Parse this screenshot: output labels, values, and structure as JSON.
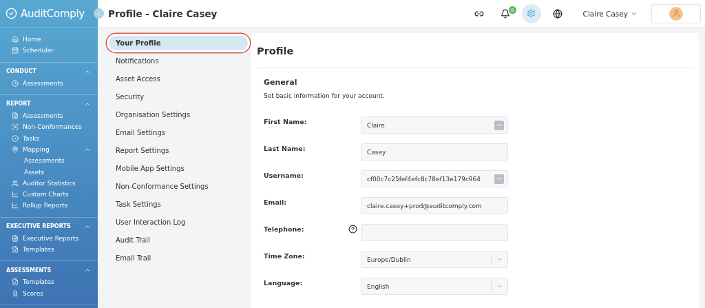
{
  "sidebar": {
    "logo": "AuditComply",
    "top_items": [
      {
        "label": "Home"
      },
      {
        "label": "Scheduler"
      }
    ],
    "sections": [
      {
        "title": "CONDUCT",
        "expanded": true,
        "items": [
          {
            "label": "Assessments"
          }
        ]
      },
      {
        "title": "REPORT",
        "expanded": true,
        "items": [
          {
            "label": "Assessments"
          },
          {
            "label": "Non-Conformances"
          },
          {
            "label": "Tasks"
          },
          {
            "label": "Mapping",
            "expanded": true,
            "children": [
              {
                "label": "Assessments"
              },
              {
                "label": "Assets"
              }
            ]
          },
          {
            "label": "Auditor Statistics"
          },
          {
            "label": "Custom Charts"
          },
          {
            "label": "Rollup Reports"
          }
        ]
      },
      {
        "title": "EXECUTIVE REPORTS",
        "expanded": true,
        "items": [
          {
            "label": "Executive Reports"
          },
          {
            "label": "Templates"
          }
        ]
      },
      {
        "title": "ASSESSMENTS",
        "expanded": true,
        "items": [
          {
            "label": "Templates"
          },
          {
            "label": "Scores"
          }
        ]
      }
    ]
  },
  "header": {
    "title": "Profile - Claire Casey",
    "notifications": "6",
    "user": "Claire Casey"
  },
  "settings_menu": [
    {
      "label": "Your Profile",
      "selected": true
    },
    {
      "label": "Notifications",
      "selected": false
    },
    {
      "label": "Asset Access",
      "selected": false
    },
    {
      "label": "Security",
      "selected": false
    },
    {
      "label": "Organisation Settings",
      "selected": false
    },
    {
      "label": "Email Settings",
      "selected": false
    },
    {
      "label": "Report Settings",
      "selected": false
    },
    {
      "label": "Mobile App Settings",
      "selected": false
    },
    {
      "label": "Non-Conformance Settings",
      "selected": false
    },
    {
      "label": "Task Settings",
      "selected": false
    },
    {
      "label": "User Interaction Log",
      "selected": false
    },
    {
      "label": "Audit Trail",
      "selected": false
    },
    {
      "label": "Email Trail",
      "selected": false
    }
  ],
  "profile": {
    "title": "Profile",
    "section": "General",
    "description": "Set basic information for your account.",
    "fields": [
      {
        "label": "First Name:",
        "kind": "text-menu",
        "value": "Claire"
      },
      {
        "label": "Last Name:",
        "kind": "text",
        "value": "Casey"
      },
      {
        "label": "Username:",
        "kind": "text-menu",
        "value": "cf00c7c25fef4efc8c78ef13e179c964"
      },
      {
        "label": "Email:",
        "kind": "text",
        "value": "claire.casey+prod@auditcomply.com"
      },
      {
        "label": "Telephone:",
        "kind": "text",
        "help": true
      },
      {
        "label": "Time Zone:",
        "kind": "select",
        "value": "Europe/Dublin"
      },
      {
        "label": "Language:",
        "kind": "select",
        "value": "English"
      }
    ]
  }
}
